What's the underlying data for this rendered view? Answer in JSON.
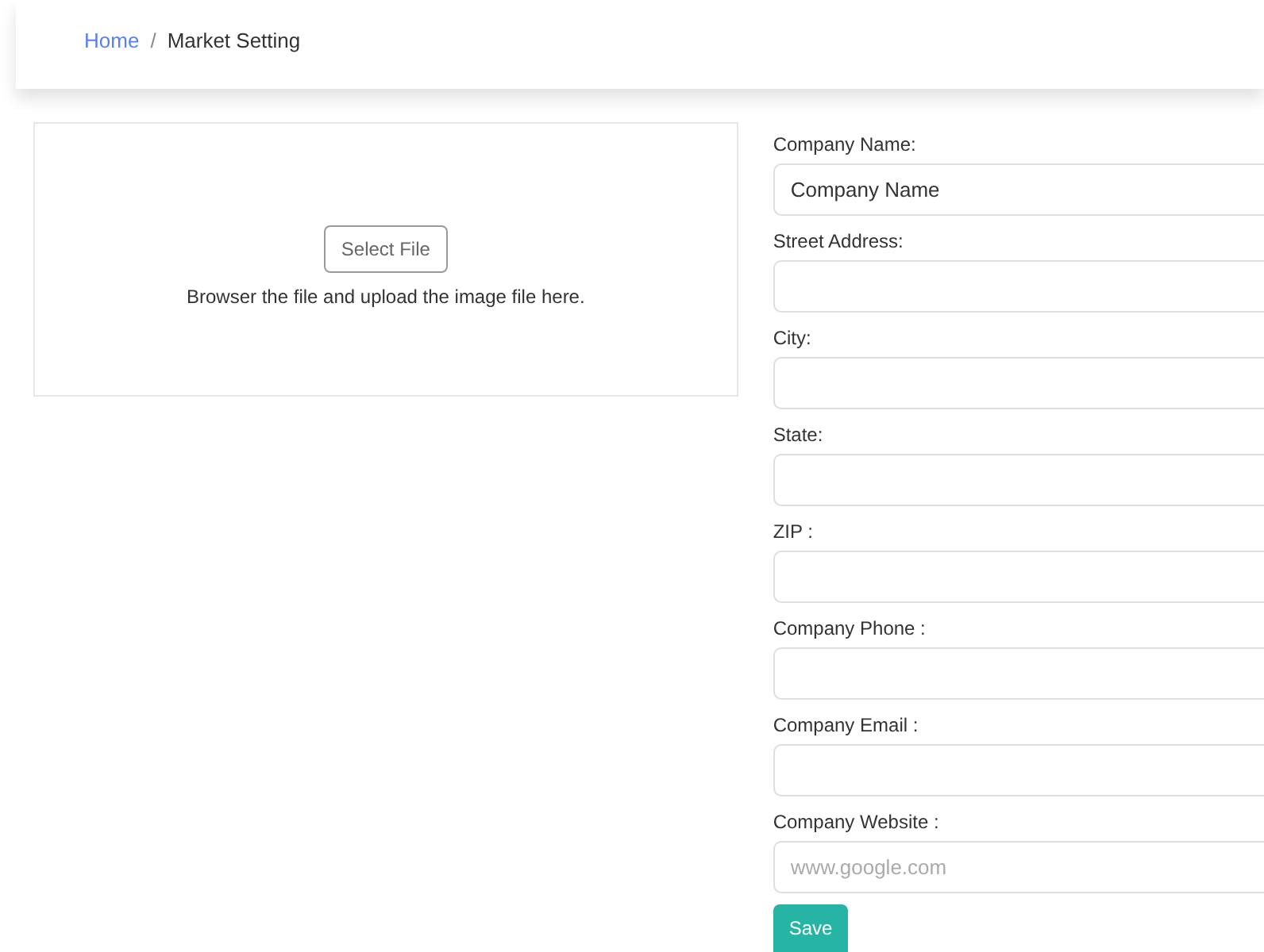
{
  "breadcrumb": [
    {
      "label": "Home",
      "kind": "link"
    },
    {
      "label": "Market Setting",
      "kind": "current"
    }
  ],
  "breadcrumb_separator": "/",
  "upload": {
    "button": "Select File",
    "hint": "Browser the file and upload the image file here."
  },
  "fields": [
    {
      "label": "Company Name:",
      "value": "Company Name"
    },
    {
      "label": "Street Address:"
    },
    {
      "label": "City:"
    },
    {
      "label": "State:"
    },
    {
      "label": "ZIP :"
    },
    {
      "label": "Company Phone :"
    },
    {
      "label": "Company Email :"
    },
    {
      "label": "Company Website :",
      "placeholder": "www.google.com"
    }
  ],
  "save_button": "Save"
}
